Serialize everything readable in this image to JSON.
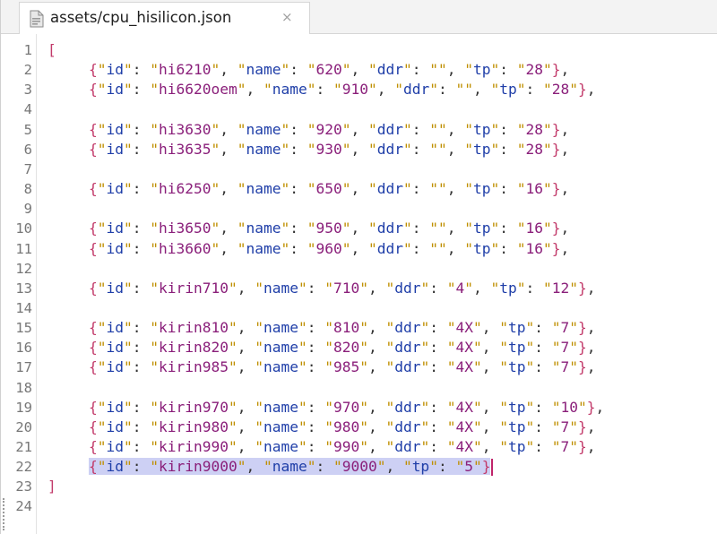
{
  "tab": {
    "title": "assets/cpu_hisilicon.json",
    "close_glyph": "×",
    "icon": "json-file-icon"
  },
  "editor": {
    "lines": [
      {
        "num": "1",
        "kind": "open",
        "text": "["
      },
      {
        "num": "2",
        "kind": "entry",
        "id": "hi6210",
        "name": "620",
        "ddr": "",
        "tp": "28",
        "trail": ","
      },
      {
        "num": "3",
        "kind": "entry",
        "id": "hi6620oem",
        "name": "910",
        "ddr": "",
        "tp": "28",
        "trail": ","
      },
      {
        "num": "4",
        "kind": "blank"
      },
      {
        "num": "5",
        "kind": "entry",
        "id": "hi3630",
        "name": "920",
        "ddr": "",
        "tp": "28",
        "trail": ","
      },
      {
        "num": "6",
        "kind": "entry",
        "id": "hi3635",
        "name": "930",
        "ddr": "",
        "tp": "28",
        "trail": ","
      },
      {
        "num": "7",
        "kind": "blank"
      },
      {
        "num": "8",
        "kind": "entry",
        "id": "hi6250",
        "name": "650",
        "ddr": "",
        "tp": "16",
        "trail": ","
      },
      {
        "num": "9",
        "kind": "blank"
      },
      {
        "num": "10",
        "kind": "entry",
        "id": "hi3650",
        "name": "950",
        "ddr": "",
        "tp": "16",
        "trail": ","
      },
      {
        "num": "11",
        "kind": "entry",
        "id": "hi3660",
        "name": "960",
        "ddr": "",
        "tp": "16",
        "trail": ","
      },
      {
        "num": "12",
        "kind": "blank"
      },
      {
        "num": "13",
        "kind": "entry",
        "id": "kirin710",
        "name": "710",
        "ddr": "4",
        "tp": "12",
        "trail": ","
      },
      {
        "num": "14",
        "kind": "blank"
      },
      {
        "num": "15",
        "kind": "entry",
        "id": "kirin810",
        "name": "810",
        "ddr": "4X",
        "tp": "7",
        "trail": ","
      },
      {
        "num": "16",
        "kind": "entry",
        "id": "kirin820",
        "name": "820",
        "ddr": "4X",
        "tp": "7",
        "trail": ","
      },
      {
        "num": "17",
        "kind": "entry",
        "id": "kirin985",
        "name": "985",
        "ddr": "4X",
        "tp": "7",
        "trail": ","
      },
      {
        "num": "18",
        "kind": "blank"
      },
      {
        "num": "19",
        "kind": "entry",
        "id": "kirin970",
        "name": "970",
        "ddr": "4X",
        "tp": "10",
        "trail": ","
      },
      {
        "num": "20",
        "kind": "entry",
        "id": "kirin980",
        "name": "980",
        "ddr": "4X",
        "tp": "7",
        "trail": ","
      },
      {
        "num": "21",
        "kind": "entry",
        "id": "kirin990",
        "name": "990",
        "ddr": "4X",
        "tp": "7",
        "trail": ","
      },
      {
        "num": "22",
        "kind": "entry",
        "id": "kirin9000",
        "name": "9000",
        "tp": "5",
        "trail": "",
        "selected": true,
        "cursor": true
      },
      {
        "num": "23",
        "kind": "close",
        "text": "]"
      },
      {
        "num": "24",
        "kind": "blank"
      }
    ]
  },
  "colors": {
    "key": "#1f3ea8",
    "string": "#8a1f7a",
    "quote": "#bf8f00",
    "bracket": "#c23a6a",
    "selection": "#cdd0f4"
  }
}
